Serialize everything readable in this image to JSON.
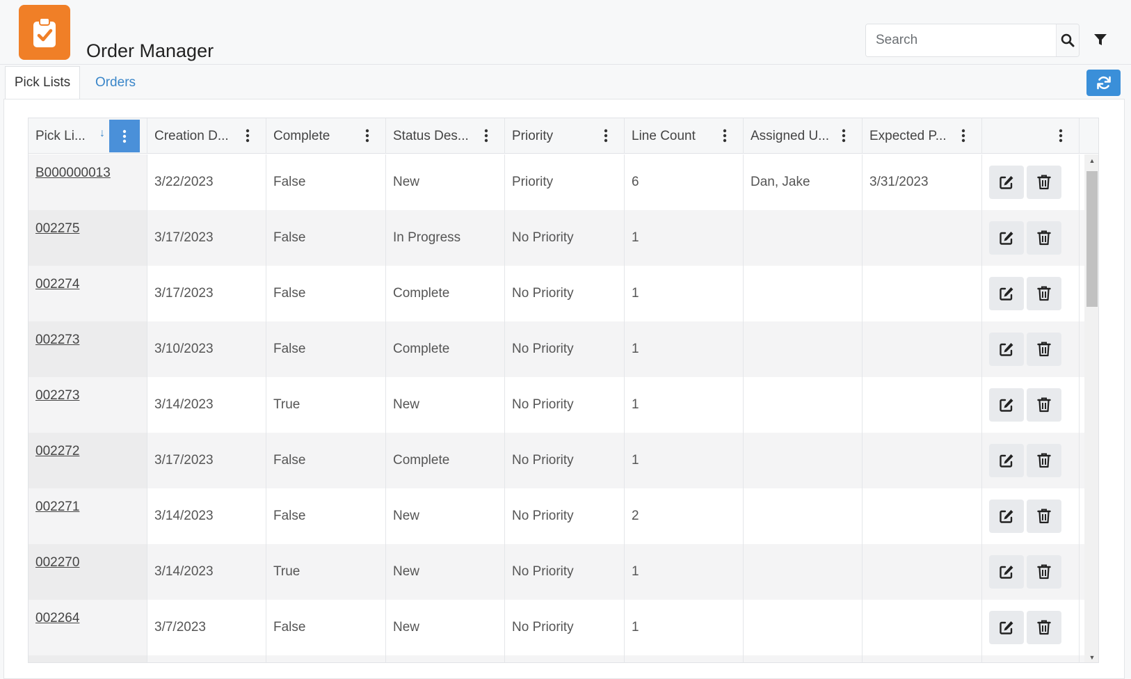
{
  "app": {
    "title": "Order Manager",
    "logo_icon": "clipboard-check-icon",
    "brand_color": "#f07f27"
  },
  "search": {
    "placeholder": "Search",
    "value": ""
  },
  "tabs": [
    {
      "label": "Pick Lists",
      "active": true
    },
    {
      "label": "Orders",
      "active": false
    }
  ],
  "accent_color": "#3a8fd9",
  "grid": {
    "columns": [
      {
        "label": "Pick Li...",
        "sorted": "descending"
      },
      {
        "label": "Creation D..."
      },
      {
        "label": "Complete"
      },
      {
        "label": "Status Des..."
      },
      {
        "label": "Priority"
      },
      {
        "label": "Line Count"
      },
      {
        "label": "Assigned U..."
      },
      {
        "label": "Expected P..."
      },
      {
        "label": ""
      }
    ],
    "rows": [
      {
        "id": "B000000013",
        "created": "3/22/2023",
        "complete": "False",
        "status": "New",
        "priority": "Priority",
        "lines": "6",
        "assigned": "Dan, Jake",
        "expected": "3/31/2023"
      },
      {
        "id": "002275",
        "created": "3/17/2023",
        "complete": "False",
        "status": "In Progress",
        "priority": "No Priority",
        "lines": "1",
        "assigned": "",
        "expected": ""
      },
      {
        "id": "002274",
        "created": "3/17/2023",
        "complete": "False",
        "status": "Complete",
        "priority": "No Priority",
        "lines": "1",
        "assigned": "",
        "expected": ""
      },
      {
        "id": "002273",
        "created": "3/10/2023",
        "complete": "False",
        "status": "Complete",
        "priority": "No Priority",
        "lines": "1",
        "assigned": "",
        "expected": ""
      },
      {
        "id": "002273",
        "created": "3/14/2023",
        "complete": "True",
        "status": "New",
        "priority": "No Priority",
        "lines": "1",
        "assigned": "",
        "expected": ""
      },
      {
        "id": "002272",
        "created": "3/17/2023",
        "complete": "False",
        "status": "Complete",
        "priority": "No Priority",
        "lines": "1",
        "assigned": "",
        "expected": ""
      },
      {
        "id": "002271",
        "created": "3/14/2023",
        "complete": "False",
        "status": "New",
        "priority": "No Priority",
        "lines": "2",
        "assigned": "",
        "expected": ""
      },
      {
        "id": "002270",
        "created": "3/14/2023",
        "complete": "True",
        "status": "New",
        "priority": "No Priority",
        "lines": "1",
        "assigned": "",
        "expected": ""
      },
      {
        "id": "002264",
        "created": "3/7/2023",
        "complete": "False",
        "status": "New",
        "priority": "No Priority",
        "lines": "1",
        "assigned": "",
        "expected": ""
      },
      {
        "id": "",
        "created": "",
        "complete": "",
        "status": "",
        "priority": "",
        "lines": "",
        "assigned": "",
        "expected": ""
      }
    ]
  }
}
